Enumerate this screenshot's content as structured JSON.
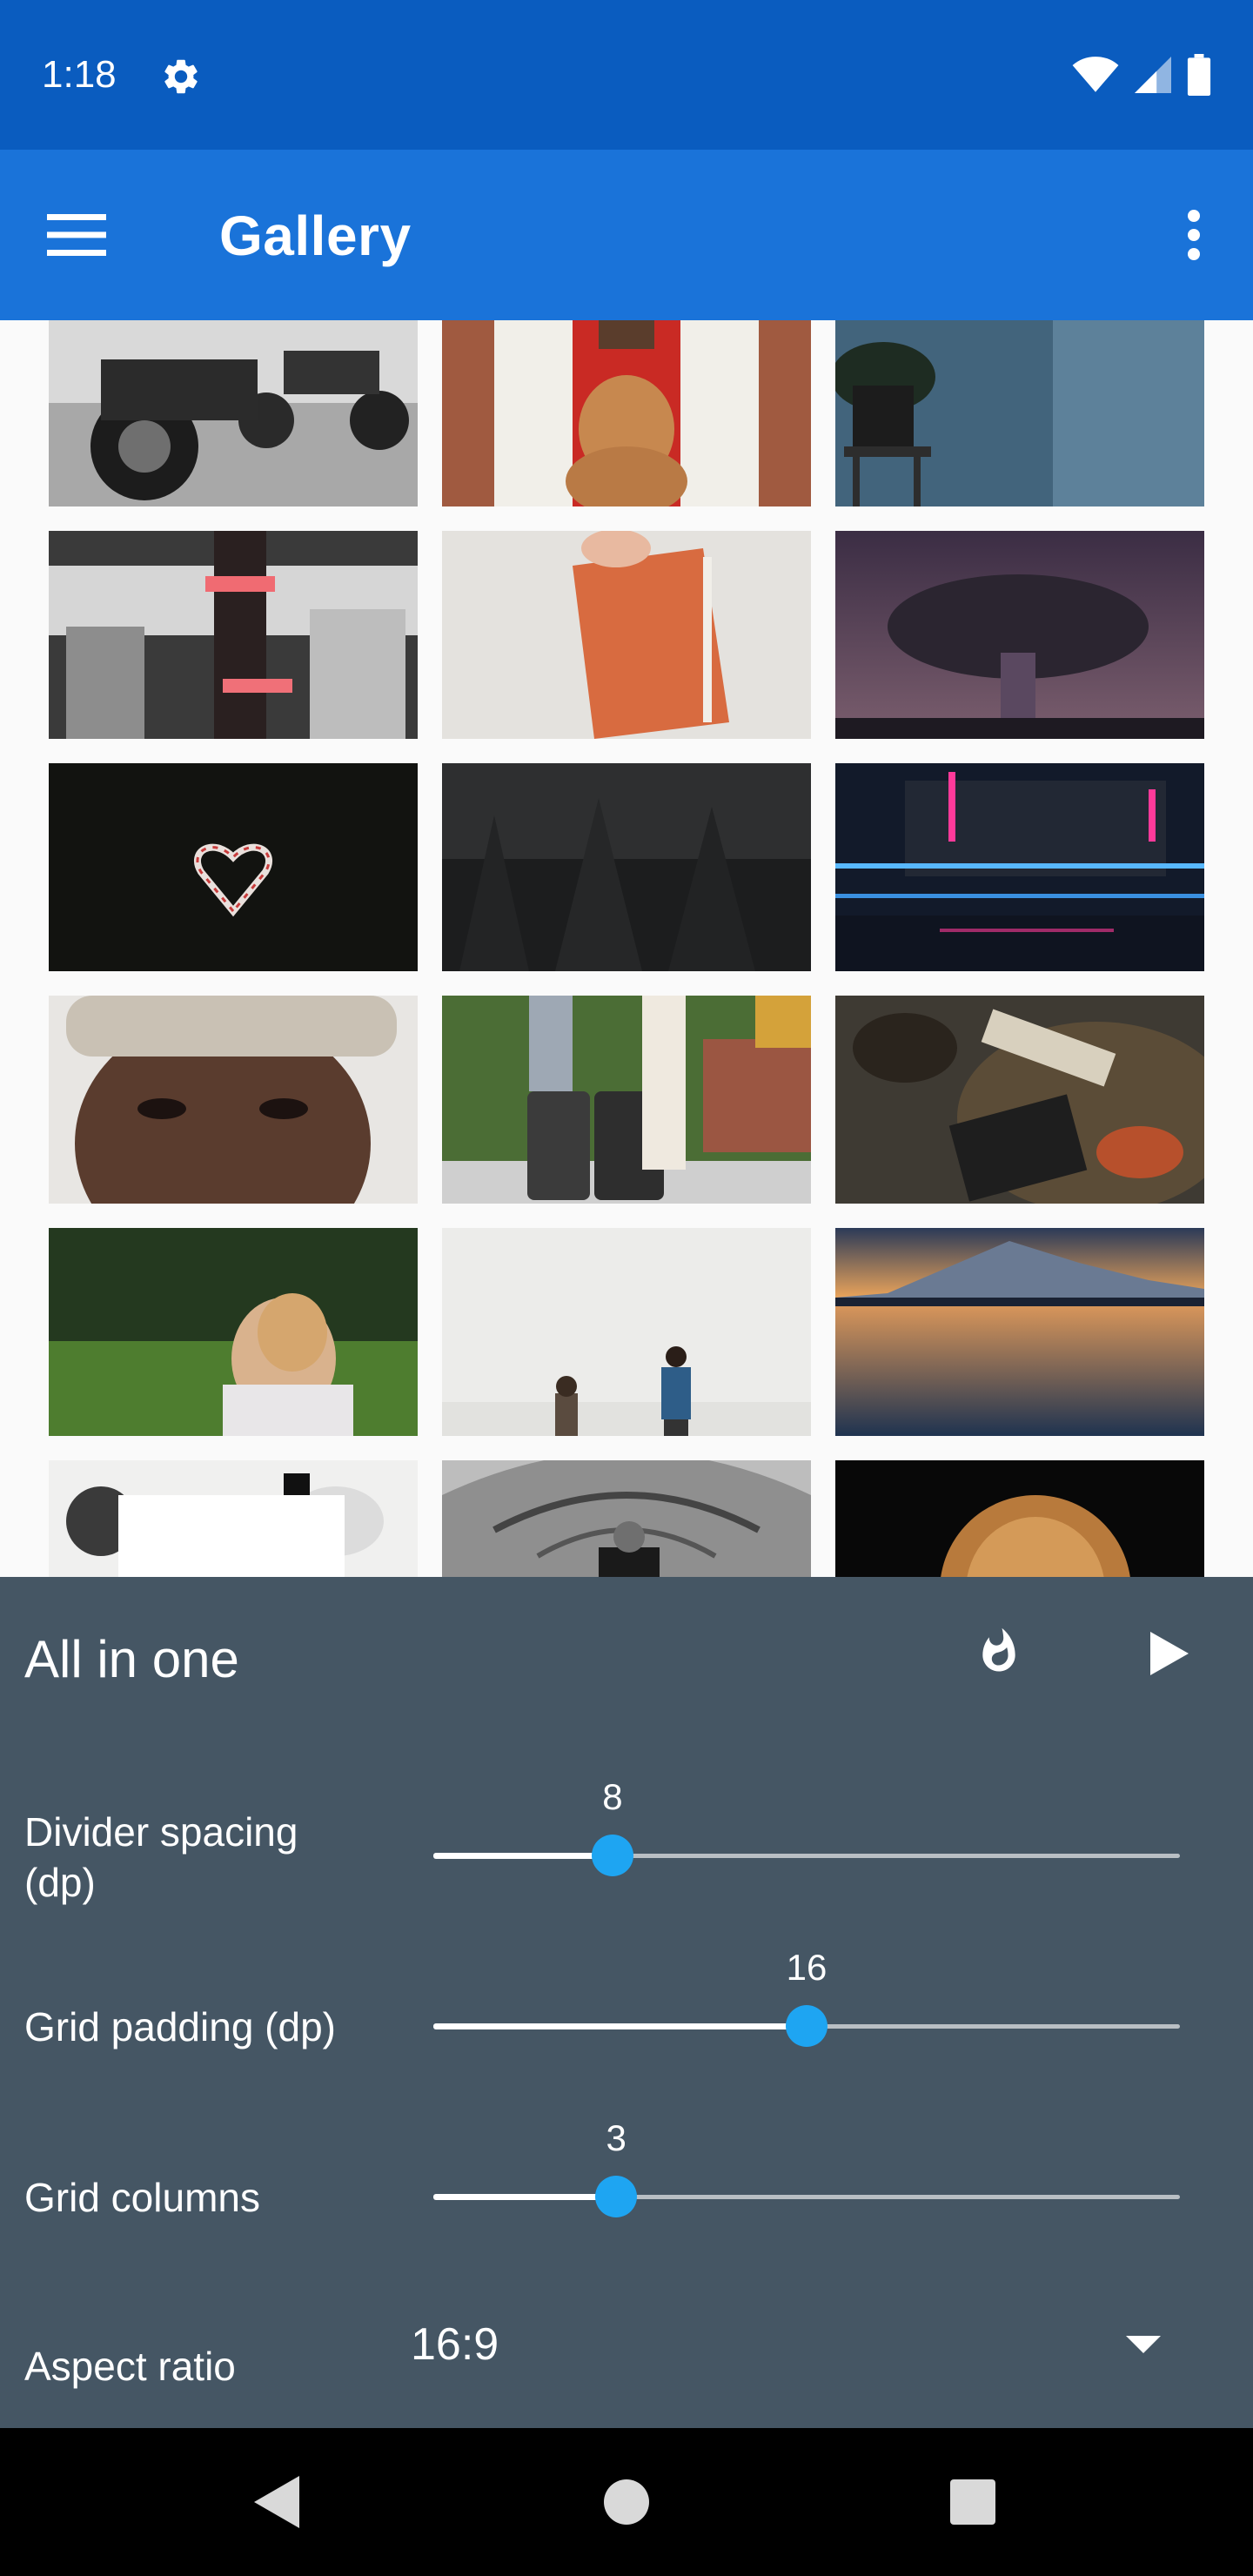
{
  "status_bar": {
    "time": "1:18",
    "icons": [
      "settings-gear-icon",
      "wifi-icon",
      "cell-signal-icon",
      "battery-icon"
    ]
  },
  "app_bar": {
    "title": "Gallery",
    "nav_icon": "hamburger-menu-icon",
    "action_icon": "more-vertical-icon",
    "color": "#1a73d9"
  },
  "gallery": {
    "columns": 3,
    "aspect_ratio": "16:9",
    "images": [
      {
        "subject": "motorcycles"
      },
      {
        "subject": "dog at red door"
      },
      {
        "subject": "potted plant blue wall"
      },
      {
        "subject": "gym fitness band"
      },
      {
        "subject": "orange notebook"
      },
      {
        "subject": "tree under starry sky"
      },
      {
        "subject": "candy cane heart"
      },
      {
        "subject": "dark foggy forest"
      },
      {
        "subject": "neon building at night"
      },
      {
        "subject": "man portrait"
      },
      {
        "subject": "couple with suitcases"
      },
      {
        "subject": "tea and table setting"
      },
      {
        "subject": "woman lying in grass"
      },
      {
        "subject": "couple in white space"
      },
      {
        "subject": "mountain lake sunset"
      },
      {
        "subject": "desk flat lay"
      },
      {
        "subject": "man in fenced walkway"
      },
      {
        "subject": "dried flower dark"
      }
    ]
  },
  "panel": {
    "title": "All in one",
    "fire_icon": "fire-icon",
    "play_icon": "play-icon",
    "controls": [
      {
        "label": "Divider spacing (dp)",
        "value": "8",
        "fraction": 0.24
      },
      {
        "label": "Grid padding (dp)",
        "value": "16",
        "fraction": 0.5
      },
      {
        "label": "Grid columns",
        "value": "3",
        "fraction": 0.245
      }
    ],
    "aspect_ratio": {
      "label": "Aspect ratio",
      "value": "16:9"
    },
    "colors": {
      "background": "#455664",
      "accent": "#1ea5f2"
    }
  },
  "nav_bar": {
    "icons": [
      "back-icon",
      "home-icon",
      "recents-icon"
    ]
  }
}
